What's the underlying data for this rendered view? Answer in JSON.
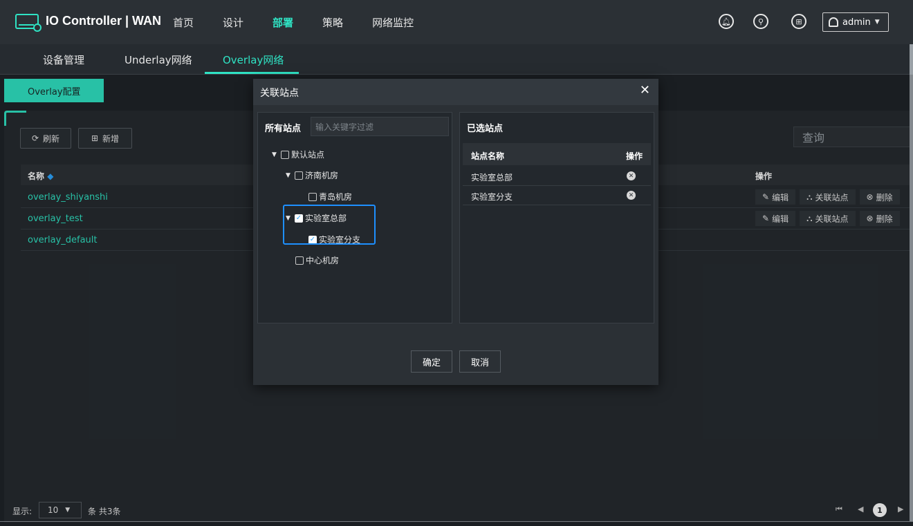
{
  "app": {
    "title": "IO Controller | WAN",
    "logo_icon": "network-monitor-icon"
  },
  "topnav": [
    {
      "label": "首页",
      "active": false
    },
    {
      "label": "设计",
      "active": false
    },
    {
      "label": "部署",
      "active": true
    },
    {
      "label": "策略",
      "active": false
    },
    {
      "label": "网络监控",
      "active": false
    }
  ],
  "header_icons": [
    "bell-icon",
    "shirt-icon",
    "apps-icon"
  ],
  "user": {
    "name": "admin"
  },
  "subnav": [
    {
      "label": "设备管理",
      "active": false
    },
    {
      "label": "Underlay网络",
      "active": false
    },
    {
      "label": "Overlay网络",
      "active": true
    }
  ],
  "config_tab": "Overlay配置",
  "toolbar": {
    "refresh": "刷新",
    "add": "新增",
    "search_placeholder": "查询"
  },
  "table": {
    "col_name": "名称",
    "col_ops": "操作",
    "rows": [
      {
        "name": "overlay_shiyanshi",
        "ops": true
      },
      {
        "name": "overlay_test",
        "ops": true
      },
      {
        "name": "overlay_default",
        "ops": false
      }
    ],
    "op_edit": "编辑",
    "op_link": "关联站点",
    "op_delete": "删除"
  },
  "footer": {
    "show_label": "显示:",
    "page_size": "10",
    "count_label": "条 共3条",
    "current_page": "1"
  },
  "modal": {
    "title": "关联站点",
    "left": {
      "title": "所有站点",
      "filter_placeholder": "输入关键字过滤",
      "tree": [
        {
          "label": "默认站点",
          "checked": false,
          "expanded": true
        },
        {
          "label": "济南机房",
          "checked": false,
          "expanded": true
        },
        {
          "label": "青岛机房",
          "checked": false
        },
        {
          "label": "实验室总部",
          "checked": true,
          "expanded": true
        },
        {
          "label": "实验室分支",
          "checked": true
        },
        {
          "label": "中心机房",
          "checked": false
        }
      ]
    },
    "right": {
      "title": "已选站点",
      "col_name": "站点名称",
      "col_ops": "操作",
      "rows": [
        "实验室总部",
        "实验室分支"
      ]
    },
    "confirm": "确定",
    "cancel": "取消"
  }
}
